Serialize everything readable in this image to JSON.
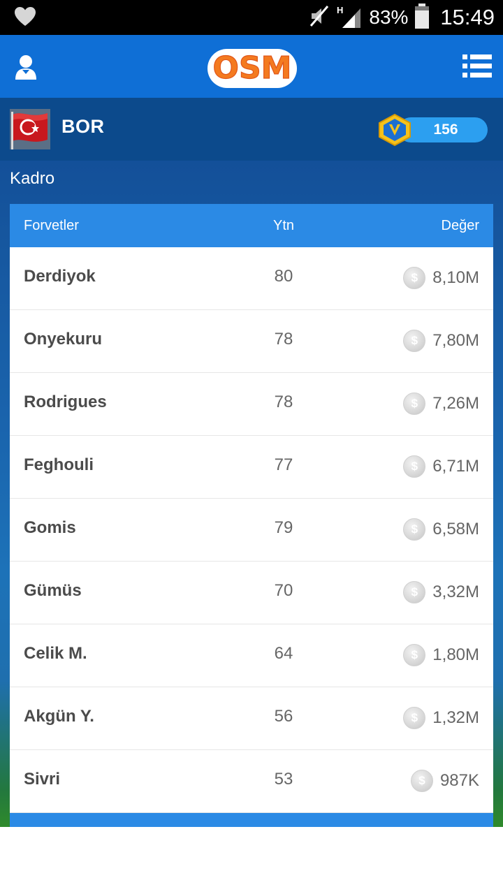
{
  "statusbar": {
    "battery": "83%",
    "time": "15:49",
    "network": "H"
  },
  "appbar": {
    "logo": "OSM"
  },
  "team": {
    "name": "BOR",
    "credits": "156"
  },
  "section_title": "Kadro",
  "table": {
    "headers": {
      "position": "Forvetler",
      "rating": "Ytn",
      "value": "Değer"
    },
    "currency_symbol": "$",
    "rows": [
      {
        "name": "Derdiyok",
        "rating": "80",
        "value": "8,10M"
      },
      {
        "name": "Onyekuru",
        "rating": "78",
        "value": "7,80M"
      },
      {
        "name": "Rodrigues",
        "rating": "78",
        "value": "7,26M"
      },
      {
        "name": "Feghouli",
        "rating": "77",
        "value": "6,71M"
      },
      {
        "name": "Gomis",
        "rating": "79",
        "value": "6,58M"
      },
      {
        "name": "Gümüs",
        "rating": "70",
        "value": "3,32M"
      },
      {
        "name": "Celik M.",
        "rating": "64",
        "value": "1,80M"
      },
      {
        "name": "Akgün Y.",
        "rating": "56",
        "value": "1,32M"
      },
      {
        "name": "Sivri",
        "rating": "53",
        "value": "987K"
      }
    ]
  }
}
